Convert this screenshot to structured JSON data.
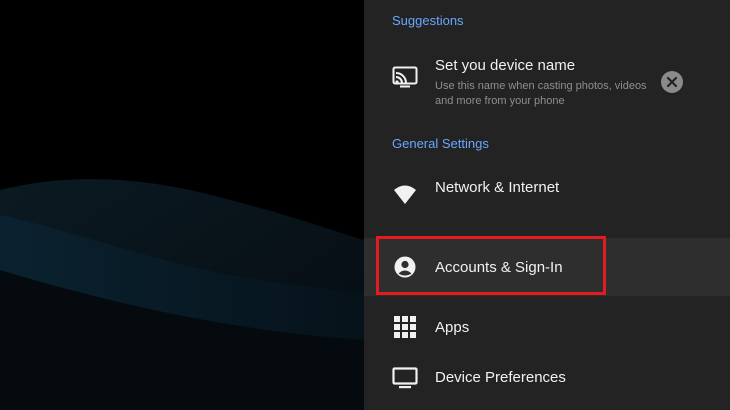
{
  "sections": {
    "suggestions_header": "Suggestions",
    "general_header": "General Settings"
  },
  "suggestion": {
    "title": "Set you device name",
    "description": "Use this name when casting photos, videos and more from your phone",
    "icon": "cast-icon",
    "dismiss_icon": "close-icon"
  },
  "settings": {
    "network": {
      "label": "Network & Internet",
      "icon": "wifi-icon"
    },
    "accounts": {
      "label": "Accounts & Sign-In",
      "icon": "account-circle-icon"
    },
    "apps": {
      "label": "Apps",
      "icon": "apps-grid-icon"
    },
    "device": {
      "label": "Device Preferences",
      "icon": "tv-icon"
    }
  },
  "colors": {
    "accent": "#6aa7ff",
    "panel_bg": "#232323",
    "highlight": "#e51b23"
  }
}
